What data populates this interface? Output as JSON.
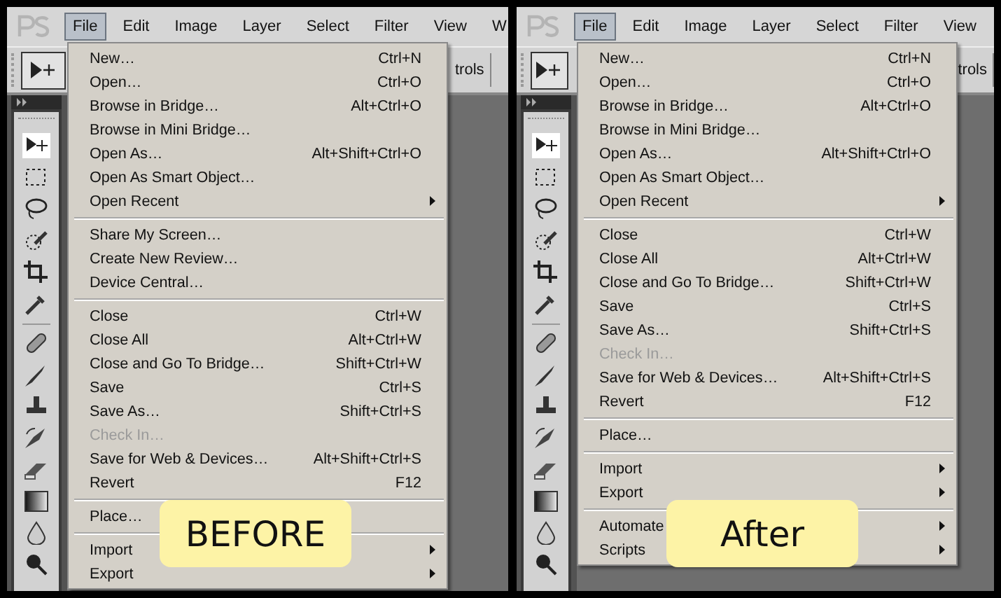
{
  "panels": [
    {
      "badge": "BEFORE",
      "menu_bar": [
        {
          "label": "File",
          "selected": true
        },
        {
          "label": "Edit",
          "selected": false
        },
        {
          "label": "Image",
          "selected": false
        },
        {
          "label": "Layer",
          "selected": false
        },
        {
          "label": "Select",
          "selected": false
        },
        {
          "label": "Filter",
          "selected": false
        },
        {
          "label": "View",
          "selected": false
        },
        {
          "label": "W",
          "selected": false
        }
      ],
      "options_text": "trols",
      "menu": [
        {
          "kind": "item",
          "label": "New…",
          "shortcut": "Ctrl+N"
        },
        {
          "kind": "item",
          "label": "Open…",
          "shortcut": "Ctrl+O"
        },
        {
          "kind": "item",
          "label": "Browse in Bridge…",
          "shortcut": "Alt+Ctrl+O"
        },
        {
          "kind": "item",
          "label": "Browse in Mini Bridge…"
        },
        {
          "kind": "item",
          "label": "Open As…",
          "shortcut": "Alt+Shift+Ctrl+O"
        },
        {
          "kind": "item",
          "label": "Open As Smart Object…"
        },
        {
          "kind": "item",
          "label": "Open Recent",
          "submenu": true
        },
        {
          "kind": "separator"
        },
        {
          "kind": "item",
          "label": "Share My Screen…"
        },
        {
          "kind": "item",
          "label": "Create New Review…"
        },
        {
          "kind": "item",
          "label": "Device Central…"
        },
        {
          "kind": "separator"
        },
        {
          "kind": "item",
          "label": "Close",
          "shortcut": "Ctrl+W"
        },
        {
          "kind": "item",
          "label": "Close All",
          "shortcut": "Alt+Ctrl+W"
        },
        {
          "kind": "item",
          "label": "Close and Go To Bridge…",
          "shortcut": "Shift+Ctrl+W"
        },
        {
          "kind": "item",
          "label": "Save",
          "shortcut": "Ctrl+S"
        },
        {
          "kind": "item",
          "label": "Save As…",
          "shortcut": "Shift+Ctrl+S"
        },
        {
          "kind": "item",
          "label": "Check In…",
          "disabled": true
        },
        {
          "kind": "item",
          "label": "Save for Web & Devices…",
          "shortcut": "Alt+Shift+Ctrl+S"
        },
        {
          "kind": "item",
          "label": "Revert",
          "shortcut": "F12"
        },
        {
          "kind": "separator"
        },
        {
          "kind": "item",
          "label": "Place…"
        },
        {
          "kind": "separator"
        },
        {
          "kind": "item",
          "label": "Import",
          "submenu": true
        },
        {
          "kind": "item",
          "label": "Export",
          "submenu": true
        }
      ]
    },
    {
      "badge": "After",
      "menu_bar": [
        {
          "label": "File",
          "selected": true
        },
        {
          "label": "Edit",
          "selected": false
        },
        {
          "label": "Image",
          "selected": false
        },
        {
          "label": "Layer",
          "selected": false
        },
        {
          "label": "Select",
          "selected": false
        },
        {
          "label": "Filter",
          "selected": false
        },
        {
          "label": "View",
          "selected": false
        }
      ],
      "options_text": "trols",
      "menu": [
        {
          "kind": "item",
          "label": "New…",
          "shortcut": "Ctrl+N"
        },
        {
          "kind": "item",
          "label": "Open…",
          "shortcut": "Ctrl+O"
        },
        {
          "kind": "item",
          "label": "Browse in Bridge…",
          "shortcut": "Alt+Ctrl+O"
        },
        {
          "kind": "item",
          "label": "Browse in Mini Bridge…"
        },
        {
          "kind": "item",
          "label": "Open As…",
          "shortcut": "Alt+Shift+Ctrl+O"
        },
        {
          "kind": "item",
          "label": "Open As Smart Object…"
        },
        {
          "kind": "item",
          "label": "Open Recent",
          "submenu": true
        },
        {
          "kind": "separator"
        },
        {
          "kind": "item",
          "label": "Close",
          "shortcut": "Ctrl+W"
        },
        {
          "kind": "item",
          "label": "Close All",
          "shortcut": "Alt+Ctrl+W"
        },
        {
          "kind": "item",
          "label": "Close and Go To Bridge…",
          "shortcut": "Shift+Ctrl+W"
        },
        {
          "kind": "item",
          "label": "Save",
          "shortcut": "Ctrl+S"
        },
        {
          "kind": "item",
          "label": "Save As…",
          "shortcut": "Shift+Ctrl+S"
        },
        {
          "kind": "item",
          "label": "Check In…",
          "disabled": true
        },
        {
          "kind": "item",
          "label": "Save for Web & Devices…",
          "shortcut": "Alt+Shift+Ctrl+S"
        },
        {
          "kind": "item",
          "label": "Revert",
          "shortcut": "F12"
        },
        {
          "kind": "separator"
        },
        {
          "kind": "item",
          "label": "Place…"
        },
        {
          "kind": "separator"
        },
        {
          "kind": "item",
          "label": "Import",
          "submenu": true
        },
        {
          "kind": "item",
          "label": "Export",
          "submenu": true
        },
        {
          "kind": "separator"
        },
        {
          "kind": "item",
          "label": "Automate",
          "submenu": true
        },
        {
          "kind": "item",
          "label": "Scripts",
          "submenu": true
        }
      ]
    }
  ]
}
